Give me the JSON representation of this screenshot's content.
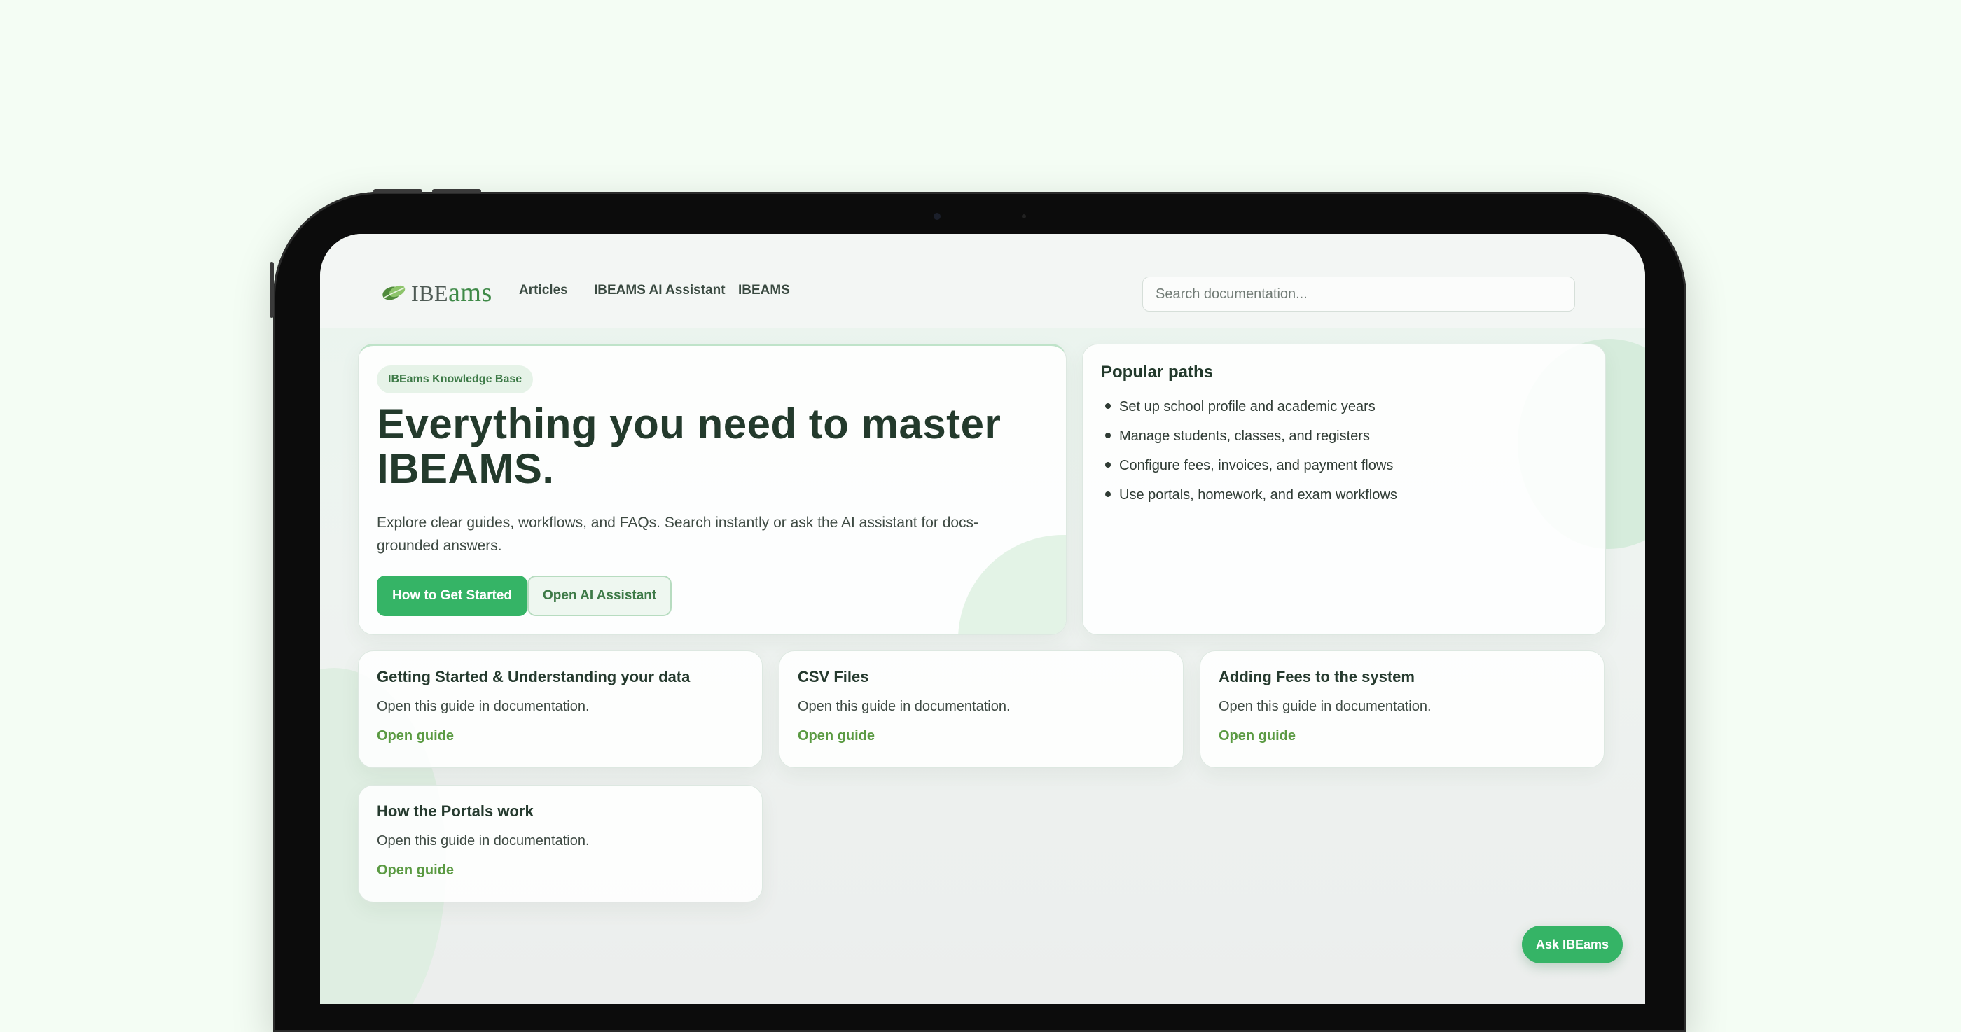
{
  "header": {
    "logo": {
      "prefix": "IBE",
      "suffix": "ams"
    },
    "nav": [
      "Articles",
      "IBEAMS AI Assistant",
      "IBEAMS"
    ],
    "search_placeholder": "Search documentation..."
  },
  "hero": {
    "badge": "IBEams Knowledge Base",
    "title_line1": "Everything you need to master",
    "title_line2": "IBEAMS.",
    "description": "Explore clear guides, workflows, and FAQs. Search instantly or ask the AI assistant for docs-grounded answers.",
    "primary_button": "How to Get Started",
    "secondary_button": "Open AI Assistant"
  },
  "popular_paths": {
    "title": "Popular paths",
    "items": [
      "Set up school profile and academic years",
      "Manage students, classes, and registers",
      "Configure fees, invoices, and payment flows",
      "Use portals, homework, and exam workflows"
    ]
  },
  "guides": [
    {
      "title": "Getting Started & Understanding your data",
      "description": "Open this guide in documentation.",
      "link": "Open guide"
    },
    {
      "title": "CSV Files",
      "description": "Open this guide in documentation.",
      "link": "Open guide"
    },
    {
      "title": "Adding Fees to the system",
      "description": "Open this guide in documentation.",
      "link": "Open guide"
    },
    {
      "title": "How the Portals work",
      "description": "Open this guide in documentation.",
      "link": "Open guide"
    }
  ],
  "ask_button": "Ask IBEams",
  "colors": {
    "accent": "#35b466",
    "link": "#5a9a42",
    "heading": "#233a2c",
    "background": "#f4fdf4"
  },
  "icons": [
    "leaf-logo-icon",
    "bullet-icon"
  ]
}
